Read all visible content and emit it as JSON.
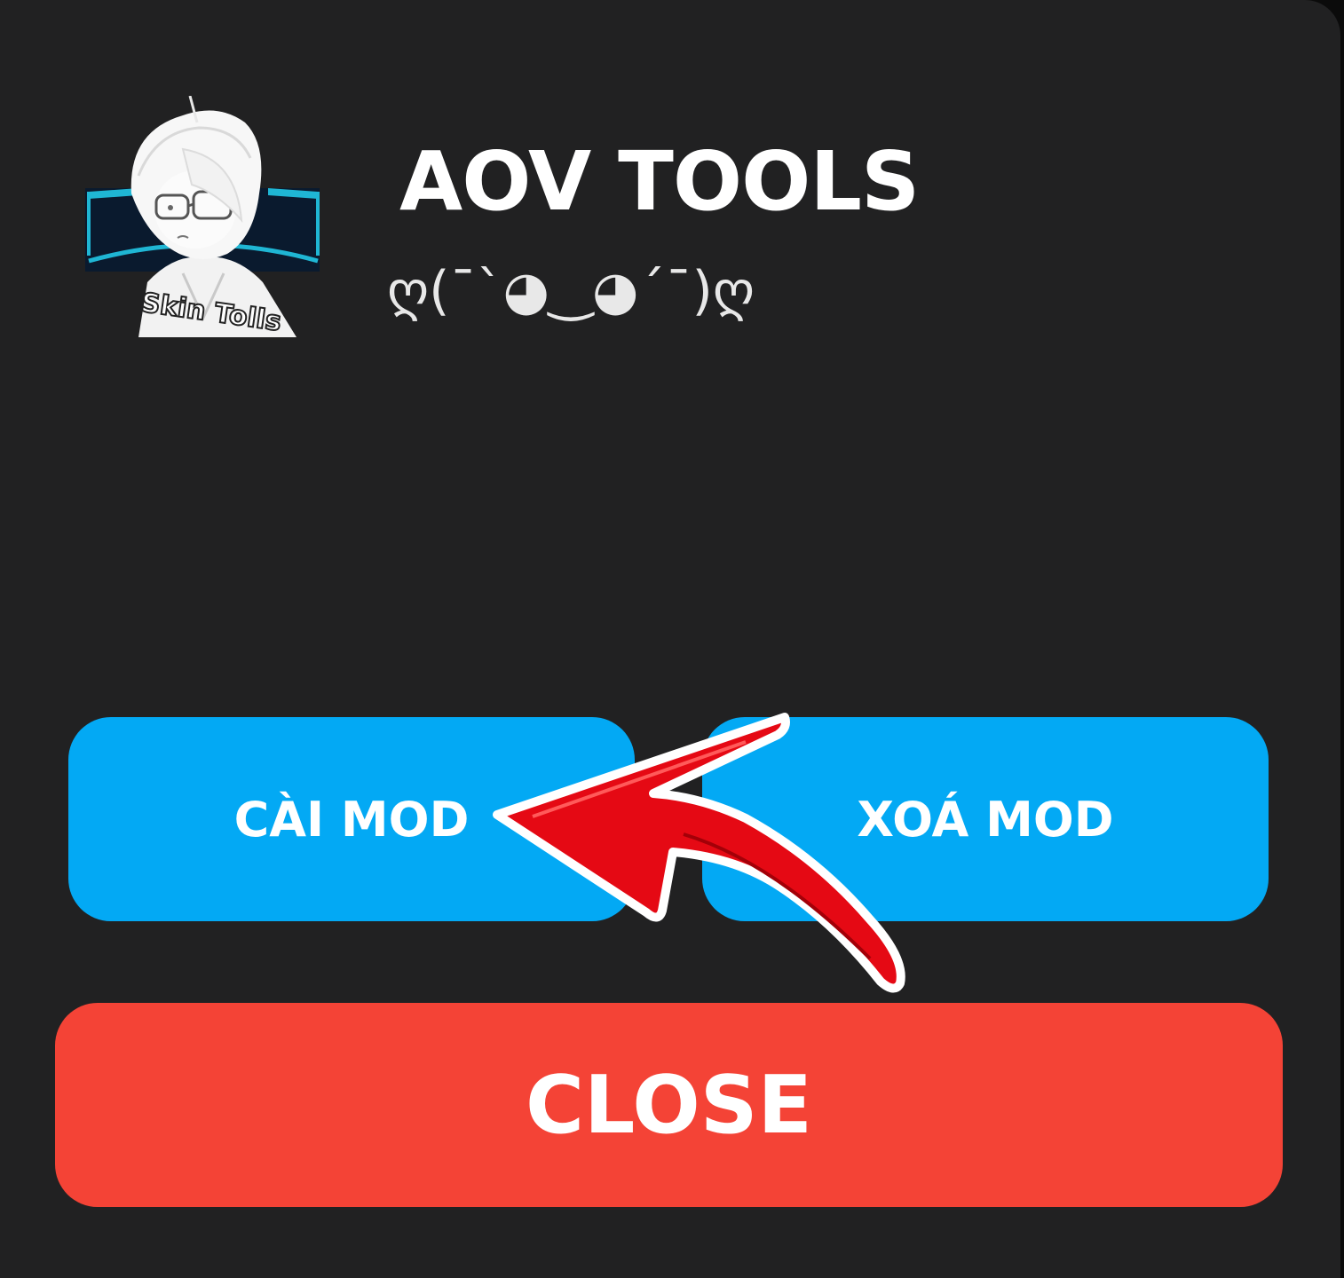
{
  "app": {
    "title": "AOV TOOLS",
    "subtitle": "ღ(¯`◕‿◕´¯)ღ",
    "logo_text": "Skin Tolls"
  },
  "buttons": {
    "install_label": "CÀI MOD",
    "remove_label": "XOÁ MOD",
    "close_label": "CLOSE"
  },
  "colors": {
    "background": "#212122",
    "primary_button": "#03a9f4",
    "close_button": "#f44336",
    "annotation_arrow": "#e50914"
  }
}
